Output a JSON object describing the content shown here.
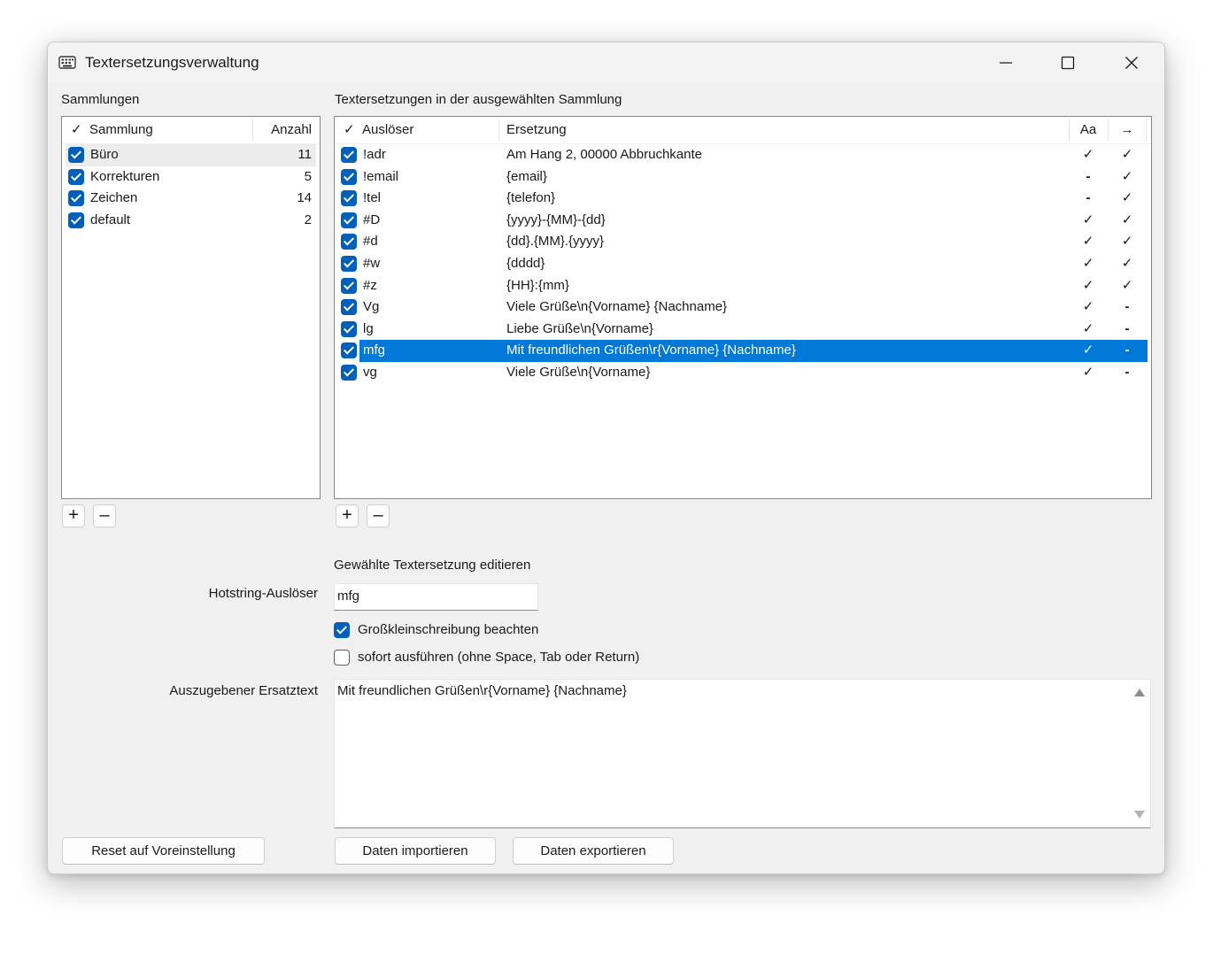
{
  "window": {
    "title": "Textersetzungsverwaltung"
  },
  "collections": {
    "label": "Sammlungen",
    "headers": {
      "check": "✓",
      "name": "Sammlung",
      "count": "Anzahl"
    },
    "rows": [
      {
        "name": "Büro",
        "count": "11",
        "checked": true
      },
      {
        "name": "Korrekturen",
        "count": "5",
        "checked": true
      },
      {
        "name": "Zeichen",
        "count": "14",
        "checked": true
      },
      {
        "name": "default",
        "count": "2",
        "checked": true
      }
    ],
    "add_label": "+",
    "remove_label": "–"
  },
  "replacements": {
    "label": "Textersetzungen in der ausgewählten Sammlung",
    "headers": {
      "check": "✓",
      "trigger": "Auslöser",
      "replacement": "Ersetzung",
      "case": "Aa",
      "immediate": "→"
    },
    "rows": [
      {
        "trigger": "!adr",
        "replacement": "Am Hang 2, 00000 Abbruchkante",
        "case": "✓",
        "immediate": "✓"
      },
      {
        "trigger": "!email",
        "replacement": "{email}",
        "case": "-",
        "immediate": "✓"
      },
      {
        "trigger": "!tel",
        "replacement": "{telefon}",
        "case": "-",
        "immediate": "✓"
      },
      {
        "trigger": "#D",
        "replacement": "{yyyy}-{MM}-{dd}",
        "case": "✓",
        "immediate": "✓"
      },
      {
        "trigger": "#d",
        "replacement": "{dd}.{MM}.{yyyy}",
        "case": "✓",
        "immediate": "✓"
      },
      {
        "trigger": "#w",
        "replacement": "{dddd}",
        "case": "✓",
        "immediate": "✓"
      },
      {
        "trigger": "#z",
        "replacement": "{HH}:{mm}",
        "case": "✓",
        "immediate": "✓"
      },
      {
        "trigger": "Vg",
        "replacement": "Viele Grüße\\n{Vorname} {Nachname}",
        "case": "✓",
        "immediate": "-"
      },
      {
        "trigger": "lg",
        "replacement": "Liebe Grüße\\n{Vorname}",
        "case": "✓",
        "immediate": "-"
      },
      {
        "trigger": "mfg",
        "replacement": "Mit freundlichen Grüßen\\r{Vorname} {Nachname}",
        "case": "✓",
        "immediate": "-"
      },
      {
        "trigger": "vg",
        "replacement": "Viele Grüße\\n{Vorname}",
        "case": "✓",
        "immediate": "-"
      }
    ],
    "selected_trigger": "mfg",
    "add_label": "+",
    "remove_label": "–"
  },
  "editor": {
    "heading": "Gewählte Textersetzung editieren",
    "trigger_label": "Hotstring-Auslöser",
    "trigger_value": "mfg",
    "case_label": "Großkleinschreibung beachten",
    "case_checked": true,
    "immediate_label": "sofort ausführen (ohne Space, Tab oder Return)",
    "immediate_checked": false,
    "text_label": "Auszugebener Ersatztext",
    "text_value": "Mit freundlichen Grüßen\\r{Vorname} {Nachname}"
  },
  "buttons": {
    "reset": "Reset auf Voreinstellung",
    "import": "Daten importieren",
    "export": "Daten exportieren"
  },
  "colors": {
    "accent": "#0078d7",
    "checkbox": "#005fb8",
    "window_bg": "#f0f0f0"
  }
}
